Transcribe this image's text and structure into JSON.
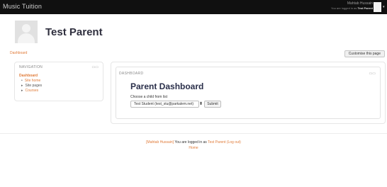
{
  "navbar": {
    "site_name": "Music Tuition",
    "user_name": "Mahtab Hussain",
    "logged_in_prefix": "You are logged in as",
    "logged_in_user": "Test Parent"
  },
  "page_header": {
    "title": "Test Parent"
  },
  "breadcrumb": {
    "current": "Dashboard"
  },
  "actions": {
    "customise_label": "Customise this page"
  },
  "navigation_block": {
    "title": "NAVIGATION",
    "root_item": "Dashboard",
    "items": [
      {
        "label": "Site home"
      },
      {
        "label": "Site pages"
      },
      {
        "label": "Courses"
      }
    ]
  },
  "dashboard_block": {
    "header": "DASHBOARD",
    "title": "Parent Dashboard",
    "choose_label": "Choose a child from list",
    "select_value": "Test Student (test_stu@parkalem.net)",
    "submit_label": "Submit"
  },
  "footer": {
    "user_link": "[Mahtab Hussain]",
    "logged_in_text": "You are logged in as",
    "user_profile_link": "Test Parent",
    "logout_link": "(Log out)",
    "home_link": "Home"
  }
}
